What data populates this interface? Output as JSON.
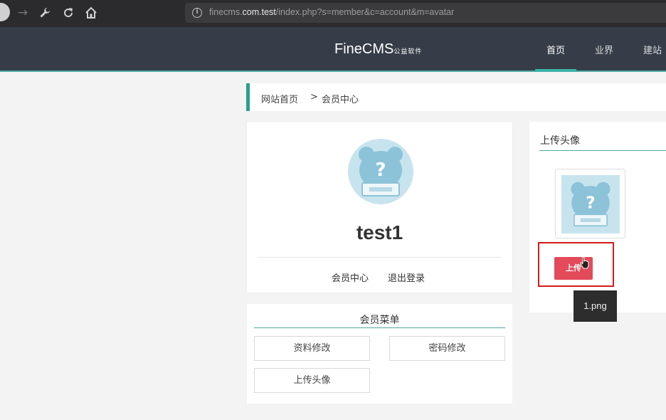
{
  "browser": {
    "url_prefix": "finecms.",
    "url_domain": "com.test",
    "url_path": "/index.php?s=member&c=account&m=avatar"
  },
  "header": {
    "logo_main": "FineCMS",
    "logo_sub": "公益软件",
    "nav": [
      "首页",
      "业界",
      "建站"
    ],
    "active_nav": "首页",
    "accent_color": "#3bb3a9"
  },
  "breadcrumb": {
    "home": "网站首页",
    "separator": ">",
    "current": "会员中心"
  },
  "profile": {
    "username": "test1",
    "link_center": "会员中心",
    "link_logout": "退出登录"
  },
  "member_menu": {
    "title": "会员菜单",
    "items": [
      "资料修改",
      "密码修改",
      "上传头像"
    ]
  },
  "upload": {
    "title": "上传头像",
    "button_label": "上传",
    "tooltip": "1.png",
    "button_color": "#e34a5a",
    "highlight_color": "#d21b1b"
  }
}
